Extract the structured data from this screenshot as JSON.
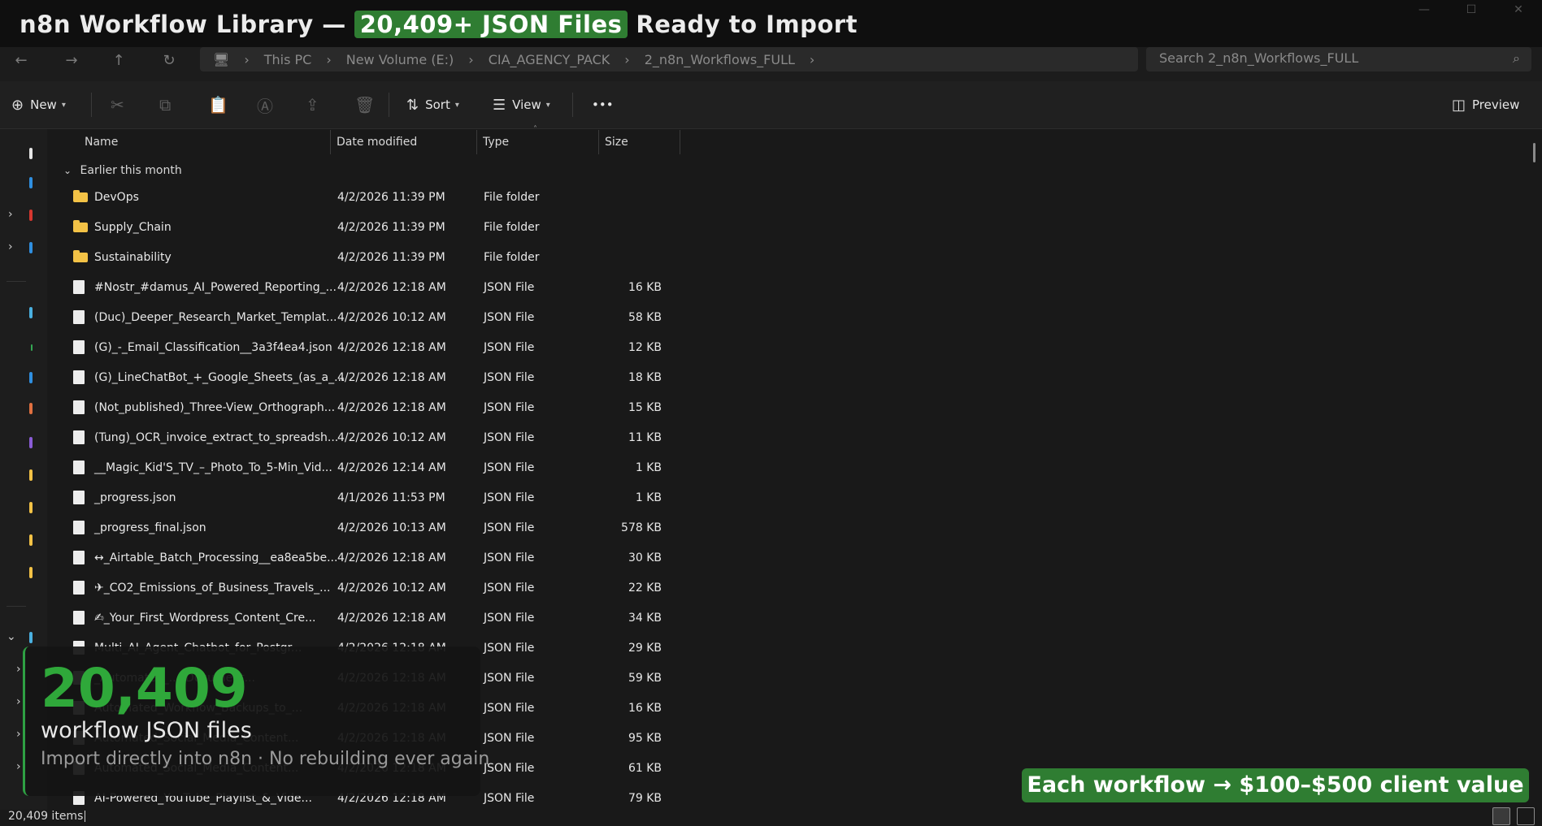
{
  "banner": {
    "prefix": "n8n Workflow Library —",
    "highlight": "20,409+ JSON Files",
    "suffix": "Ready to Import"
  },
  "nav": {
    "back_icon": "arrow-left-icon",
    "forward_icon": "arrow-right-icon",
    "up_icon": "arrow-up-icon",
    "refresh_icon": "refresh-icon",
    "breadcrumb": [
      "This PC",
      "New Volume (E:)",
      "CIA_AGENCY_PACK",
      "2_n8n_Workflows_FULL"
    ],
    "search_placeholder": "Search 2_n8n_Workflows_FULL"
  },
  "toolbar": {
    "new_label": "New",
    "sort_label": "Sort",
    "view_label": "View",
    "more_label": "•••",
    "preview_label": "Preview"
  },
  "columns": {
    "name": "Name",
    "date": "Date modified",
    "type": "Type",
    "size": "Size"
  },
  "group_label": "Earlier this month",
  "rows": [
    {
      "name": "DevOps",
      "date": "4/2/2026 11:39 PM",
      "type": "File folder",
      "size": "",
      "kind": "folder"
    },
    {
      "name": "Supply_Chain",
      "date": "4/2/2026 11:39 PM",
      "type": "File folder",
      "size": "",
      "kind": "folder"
    },
    {
      "name": "Sustainability",
      "date": "4/2/2026 11:39 PM",
      "type": "File folder",
      "size": "",
      "kind": "folder"
    },
    {
      "name": "#Nostr_#damus_AI_Powered_Reporting_...",
      "date": "4/2/2026 12:18 AM",
      "type": "JSON File",
      "size": "16 KB",
      "kind": "file"
    },
    {
      "name": "(Duc)_Deeper_Research_Market_Templat...",
      "date": "4/2/2026 10:12 AM",
      "type": "JSON File",
      "size": "58 KB",
      "kind": "file"
    },
    {
      "name": "(G)_-_Email_Classification__3a3f4ea4.json",
      "date": "4/2/2026 12:18 AM",
      "type": "JSON File",
      "size": "12 KB",
      "kind": "file"
    },
    {
      "name": "(G)_LineChatBot_+_Google_Sheets_(as_a_...",
      "date": "4/2/2026 12:18 AM",
      "type": "JSON File",
      "size": "18 KB",
      "kind": "file"
    },
    {
      "name": "(Not_published)_Three-View_Orthograph...",
      "date": "4/2/2026 12:18 AM",
      "type": "JSON File",
      "size": "15 KB",
      "kind": "file"
    },
    {
      "name": "(Tung)_OCR_invoice_extract_to_spreadsh...",
      "date": "4/2/2026 10:12 AM",
      "type": "JSON File",
      "size": "11 KB",
      "kind": "file"
    },
    {
      "name": "__Magic_Kid'S_TV_–_Photo_To_5-Min_Vid...",
      "date": "4/2/2026 12:14 AM",
      "type": "JSON File",
      "size": "1 KB",
      "kind": "file"
    },
    {
      "name": "_progress.json",
      "date": "4/1/2026 11:53 PM",
      "type": "JSON File",
      "size": "1 KB",
      "kind": "file"
    },
    {
      "name": "_progress_final.json",
      "date": "4/2/2026 10:13 AM",
      "type": "JSON File",
      "size": "578 KB",
      "kind": "file"
    },
    {
      "name": "↔_Airtable_Batch_Processing__ea8ea5be...",
      "date": "4/2/2026 12:18 AM",
      "type": "JSON File",
      "size": "30 KB",
      "kind": "file"
    },
    {
      "name": "✈_CO2_Emissions_of_Business_Travels_...",
      "date": "4/2/2026 10:12 AM",
      "type": "JSON File",
      "size": "22 KB",
      "kind": "file"
    },
    {
      "name": "✍_Your_First_Wordpress_Content_Cre...",
      "date": "4/2/2026 12:18 AM",
      "type": "JSON File",
      "size": "34 KB",
      "kind": "file"
    },
    {
      "name": "Multi_AI_Agent_Chatbot_for_Postgr...",
      "date": "4/2/2026 12:18 AM",
      "type": "JSON File",
      "size": "29 KB",
      "kind": "file"
    },
    {
      "name": "_Automated_..._Document...",
      "date": "4/2/2026 12:18 AM",
      "type": "JSON File",
      "size": "59 KB",
      "kind": "file"
    },
    {
      "name": "Automated_Workflow_Backups_to_...",
      "date": "4/2/2026 12:18 AM",
      "type": "JSON File",
      "size": "16 KB",
      "kind": "file"
    },
    {
      "name": "Automated_Social_Media_Content...",
      "date": "4/2/2026 12:18 AM",
      "type": "JSON File",
      "size": "95 KB",
      "kind": "file"
    },
    {
      "name": "Automated_Social_Media_Content...",
      "date": "4/2/2026 12:18 AM",
      "type": "JSON File",
      "size": "61 KB",
      "kind": "file"
    },
    {
      "name": "AI-Powered_YouTube_Playlist_&_Vide...",
      "date": "4/2/2026 12:18 AM",
      "type": "JSON File",
      "size": "79 KB",
      "kind": "file"
    }
  ],
  "overlay": {
    "count": "20,409",
    "subtitle": "workflow JSON files",
    "tagline": "Import directly into n8n  ·  No rebuilding ever again"
  },
  "badge_text": "Each workflow → $100–$500 client value",
  "status": {
    "items": "20,409 items"
  },
  "colors": {
    "accent_green": "#2f7d32",
    "count_green": "#2fa83a",
    "folder_yellow": "#f3c246",
    "background": "#191919"
  }
}
